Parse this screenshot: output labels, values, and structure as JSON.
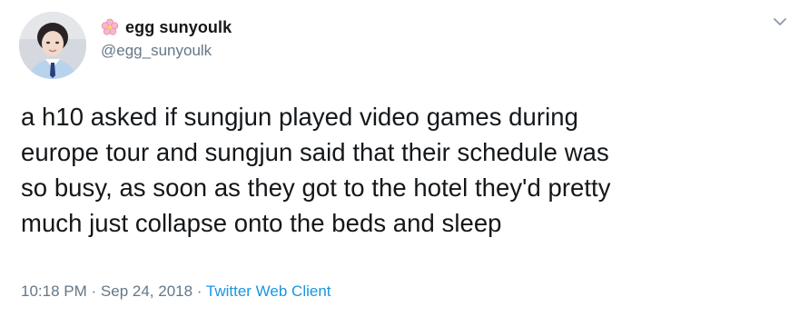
{
  "user": {
    "display_name": "egg sunyoulk",
    "handle": "@egg_sunyoulk",
    "name_emoji": "cherry-blossom-icon"
  },
  "tweet": {
    "lines": [
      "a h10 asked if sungjun played video games during",
      "europe tour and sungjun said that their schedule was",
      "so busy, as soon as they got to the hotel they'd pretty",
      "much just collapse onto the beds and sleep"
    ]
  },
  "meta": {
    "time": "10:18 PM",
    "separator1": "·",
    "date": "Sep 24, 2018",
    "separator2": "·",
    "source": "Twitter Web Client"
  },
  "colors": {
    "text": "#14171a",
    "secondary": "#657786",
    "link": "#1b95e0"
  }
}
